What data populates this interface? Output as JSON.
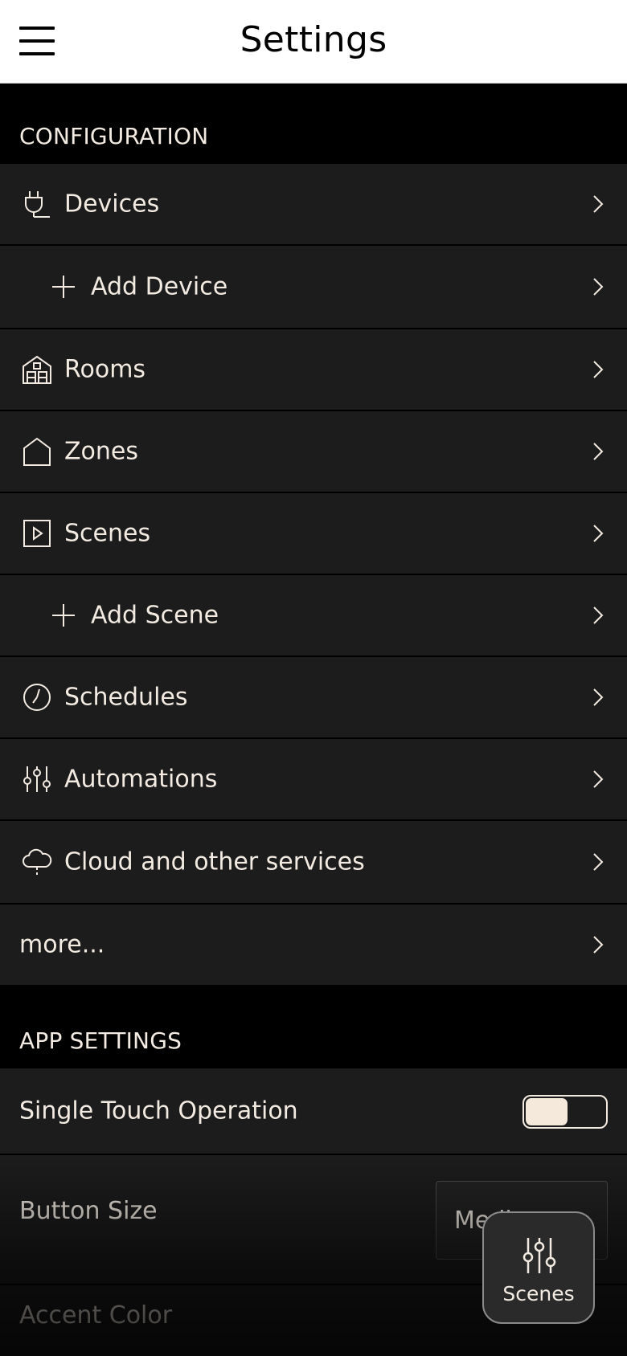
{
  "header": {
    "title": "Settings",
    "menu_icon": "hamburger-menu-icon"
  },
  "configuration": {
    "section_label": "CONFIGURATION",
    "items": [
      {
        "label": "Devices",
        "icon": "plug-icon"
      },
      {
        "label": "Add Device",
        "icon": "plus-icon"
      },
      {
        "label": "Rooms",
        "icon": "rooms-house-icon"
      },
      {
        "label": "Zones",
        "icon": "house-outline-icon"
      },
      {
        "label": "Scenes",
        "icon": "play-square-icon"
      },
      {
        "label": "Add Scene",
        "icon": "plus-icon"
      },
      {
        "label": "Schedules",
        "icon": "clock-icon"
      },
      {
        "label": "Automations",
        "icon": "sliders-icon"
      },
      {
        "label": "Cloud and other services",
        "icon": "cloud-icon"
      },
      {
        "label": "more...",
        "icon": ""
      }
    ]
  },
  "app_settings": {
    "section_label": "APP SETTINGS",
    "single_touch": {
      "label": "Single Touch Operation",
      "enabled": false
    },
    "button_size": {
      "label": "Button Size",
      "value": "Medium"
    },
    "accent_color": {
      "label": "Accent Color"
    }
  },
  "fab": {
    "label": "Scenes",
    "icon": "sliders-icon"
  },
  "colors": {
    "accent": "#f3ebe2",
    "row_bg": "#1c1c1c",
    "background": "#000000",
    "header_bg": "#ffffff"
  }
}
